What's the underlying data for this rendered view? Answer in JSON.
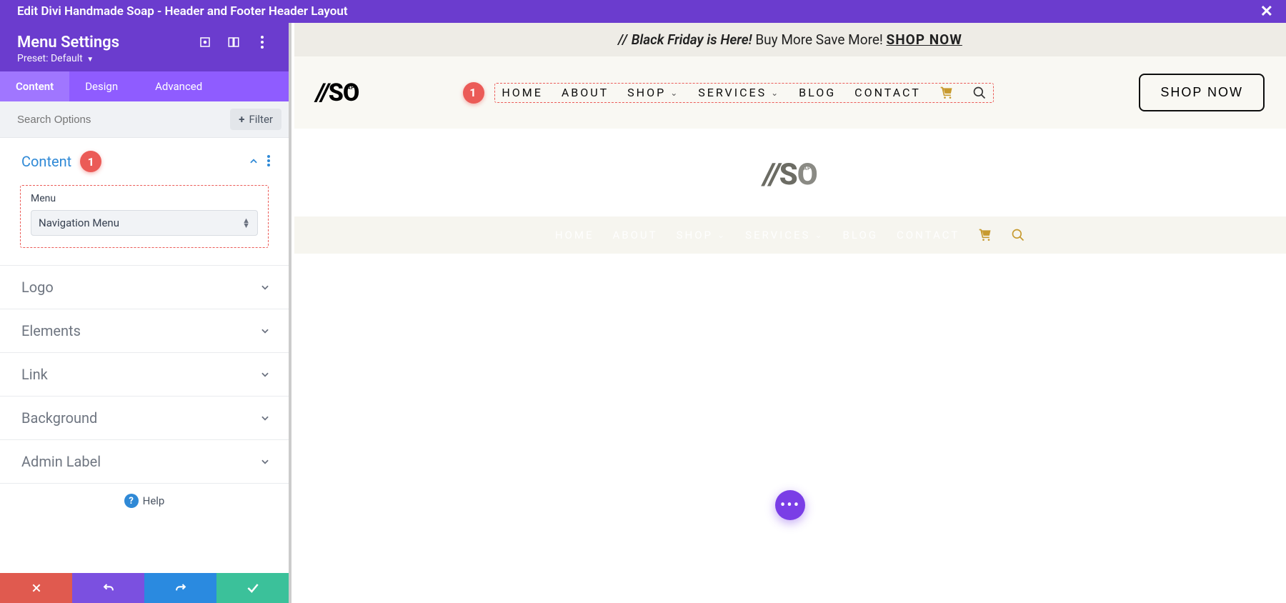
{
  "titlebar": {
    "title": "Edit Divi Handmade Soap - Header and Footer Header Layout"
  },
  "panel": {
    "heading": "Menu Settings",
    "preset_label": "Preset: Default",
    "tabs": {
      "content": "Content",
      "design": "Design",
      "advanced": "Advanced",
      "active": "content"
    },
    "search_placeholder": "Search Options",
    "filter_label": "Filter",
    "sections": {
      "content": {
        "title": "Content",
        "open": true,
        "badge": "1",
        "menu_field_label": "Menu",
        "menu_field_value": "Navigation Menu"
      },
      "logo": {
        "title": "Logo"
      },
      "elements": {
        "title": "Elements"
      },
      "link": {
        "title": "Link"
      },
      "background": {
        "title": "Background"
      },
      "adminlabel": {
        "title": "Admin Label"
      }
    },
    "help_label": "Help"
  },
  "preview": {
    "promo": {
      "slashes": "//",
      "lead": "Black Friday is Here!",
      "rest": "Buy More Save More!",
      "cta": "SHOP NOW"
    },
    "logo_text": {
      "slashes": "//",
      "s": "S",
      "o": "O"
    },
    "menu_items": [
      "HOME",
      "ABOUT",
      "SHOP",
      "SERVICES",
      "BLOG",
      "CONTACT"
    ],
    "menu_badge": "1",
    "shop_button": "SHOP NOW"
  }
}
